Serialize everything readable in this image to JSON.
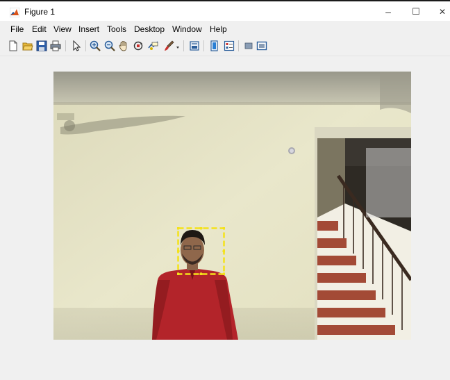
{
  "window": {
    "title": "Figure 1",
    "controls": {
      "minimize": "–",
      "maximize": "☐",
      "close": "✕"
    }
  },
  "menu": [
    {
      "label": "File"
    },
    {
      "label": "Edit"
    },
    {
      "label": "View"
    },
    {
      "label": "Insert"
    },
    {
      "label": "Tools"
    },
    {
      "label": "Desktop"
    },
    {
      "label": "Window"
    },
    {
      "label": "Help"
    }
  ],
  "toolbar": {
    "icons": [
      "new-figure-icon",
      "open-icon",
      "save-icon",
      "print-icon",
      "select-arrow-icon",
      "zoom-in-icon",
      "zoom-out-icon",
      "pan-icon",
      "rotate-3d-icon",
      "data-cursor-icon",
      "brush-icon",
      "brush-dropdown-icon",
      "link-plot-icon",
      "colorbar-icon",
      "legend-icon",
      "hide-plot-tools-icon",
      "show-plot-tools-icon"
    ]
  },
  "colors": {
    "detection_box": "#f4e21a",
    "shirt": "#b8242a",
    "wall": "#e7e4c8"
  }
}
